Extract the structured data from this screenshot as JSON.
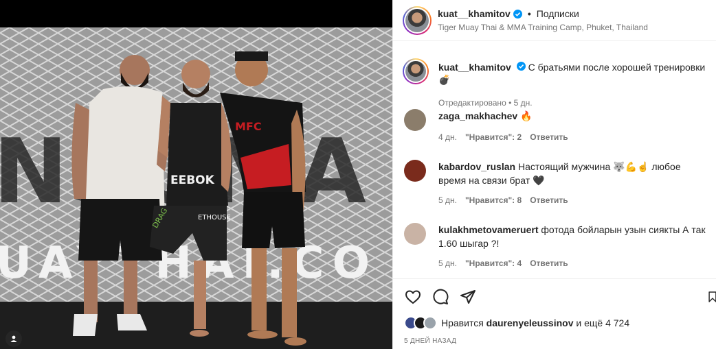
{
  "post": {
    "username": "kuat__khamitov",
    "separator": "•",
    "follow_state": "Подписки",
    "location": "Tiger Muay Thai & MMA Training Camp, Phuket, Thailand"
  },
  "photo": {
    "banner_text_1": "NSOMA",
    "banner_text_2": "UAYTHAI.CO",
    "shirt_brand": "EEBOK",
    "tshirt_logo": "MFC",
    "shorts_text": "ETHOUSE",
    "shorts_text_2": "DRAG"
  },
  "caption": {
    "username": "kuat__khamitov",
    "text": "С братьями после хорошей тренировки 💣",
    "meta": "Отредактировано • 5 дн."
  },
  "comments": [
    {
      "username": "zaga_makhachev",
      "text": "🔥",
      "age": "4 дн.",
      "likes": "\"Нравится\": 2",
      "reply": "Ответить",
      "avatar_color": "#8b7d6b"
    },
    {
      "username": "kabardov_ruslan",
      "text": "Настоящий мужчина 🐺💪☝️ любое время на связи брат 🖤",
      "age": "5 дн.",
      "likes": "\"Нравится\": 8",
      "reply": "Ответить",
      "avatar_color": "#7a2b1c"
    },
    {
      "username": "kulakhmetovameruert",
      "text": "фотода бойларын узын сиякты А так 1.60 шыгар ?!",
      "age": "5 дн.",
      "likes": "\"Нравится\": 4",
      "reply": "Ответить",
      "avatar_color": "#c9b3a5"
    }
  ],
  "actions": {
    "like_icon": "heart-icon",
    "comment_icon": "comment-icon",
    "share_icon": "share-icon",
    "save_icon": "bookmark-icon",
    "likes_prefix": "Нравится",
    "likes_user": "daurenyeleussinov",
    "likes_suffix": "и ещё 4 724",
    "date": "5 ДНЕЙ НАЗАД"
  },
  "colors": {
    "verified": "#0095f6",
    "text": "#262626",
    "muted": "#737373"
  }
}
